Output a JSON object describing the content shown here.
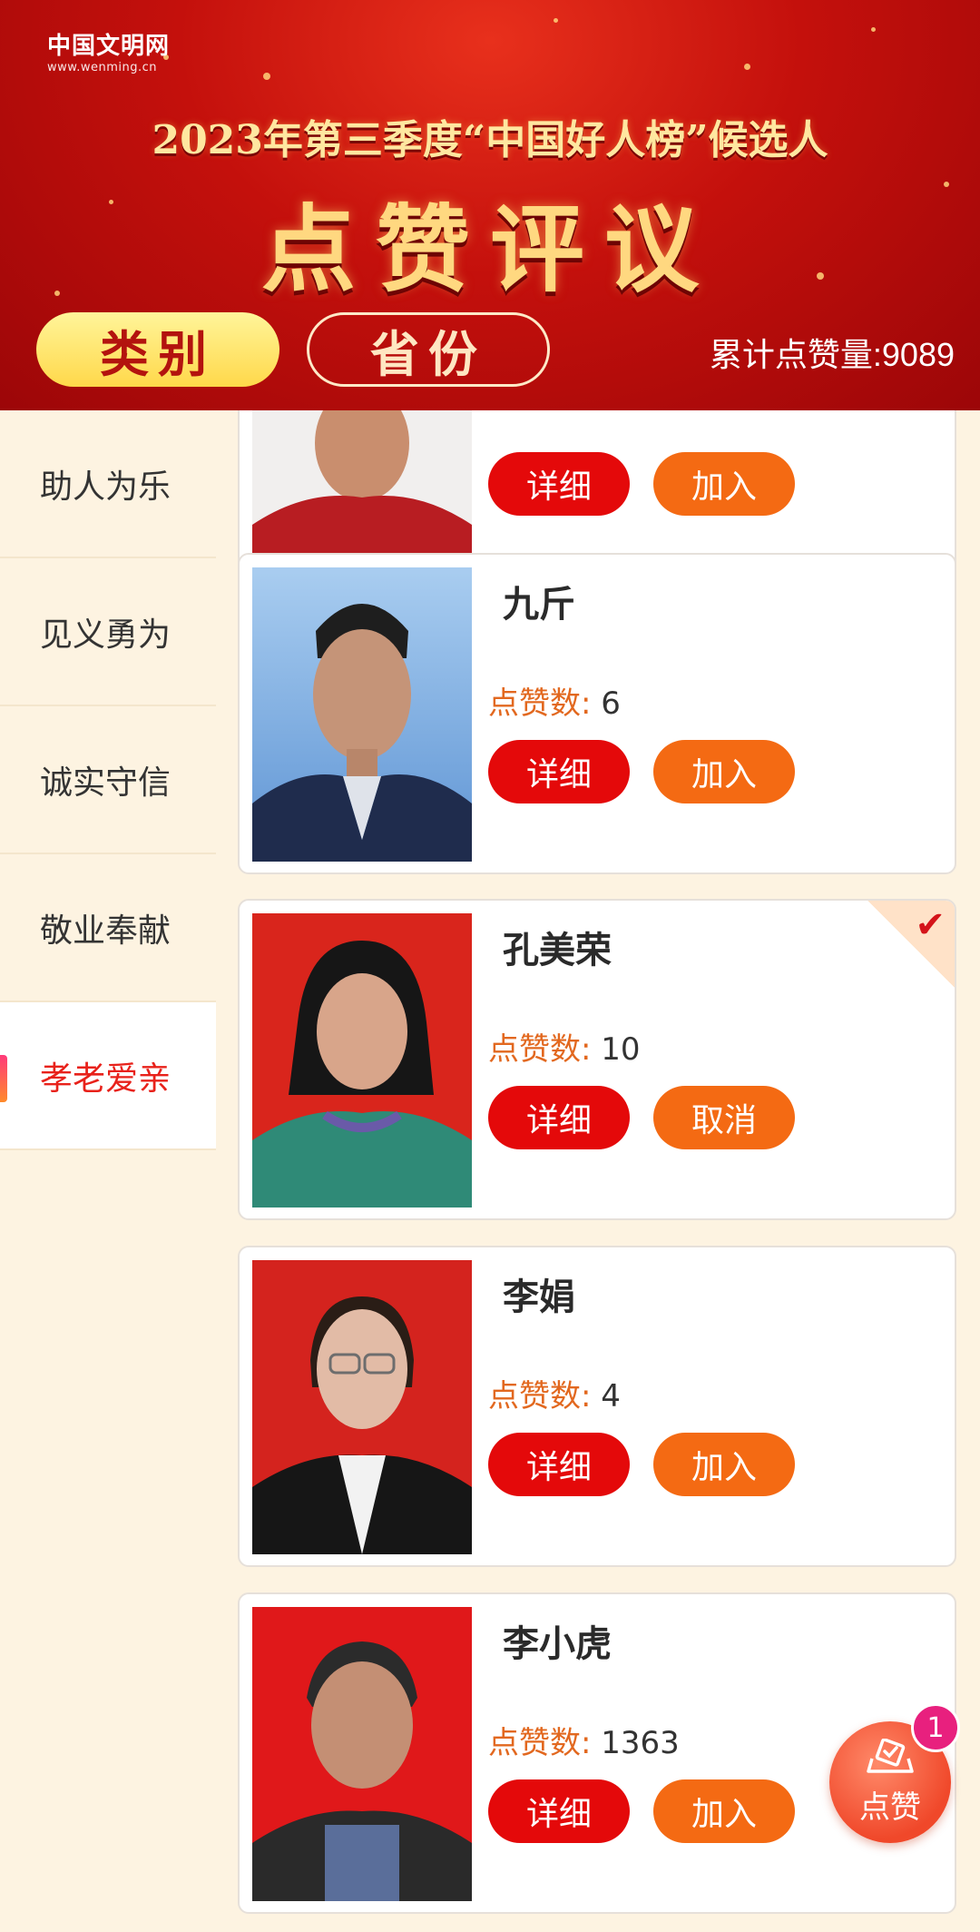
{
  "header": {
    "logo_cn": "中国文明网",
    "logo_url": "www.wenming.cn",
    "headline": "2023年第三季度“中国好人榜”候选人",
    "big_title": "点赞评议",
    "pill_category": "类别",
    "pill_province": "省份",
    "total_likes_label": "累计点赞量:9089"
  },
  "sidebar": {
    "items": [
      {
        "label": "助人为乐",
        "active": false
      },
      {
        "label": "见义勇为",
        "active": false
      },
      {
        "label": "诚实守信",
        "active": false
      },
      {
        "label": "敬业奉献",
        "active": false
      },
      {
        "label": "孝老爱亲",
        "active": true
      }
    ]
  },
  "cards": [
    {
      "name": "",
      "votes": "",
      "detail": "详细",
      "action": "加入",
      "selected": false,
      "partial": true
    },
    {
      "name": "九斤",
      "votes_label": "点赞数:",
      "votes": "6",
      "detail": "详细",
      "action": "加入",
      "selected": false
    },
    {
      "name": "孔美荣",
      "votes_label": "点赞数:",
      "votes": "10",
      "detail": "详细",
      "action": "取消",
      "selected": true
    },
    {
      "name": "李娟",
      "votes_label": "点赞数:",
      "votes": "4",
      "detail": "详细",
      "action": "加入",
      "selected": false
    },
    {
      "name": "李小虎",
      "votes_label": "点赞数:",
      "votes": "1363",
      "detail": "详细",
      "action": "加入",
      "selected": false
    }
  ],
  "fab": {
    "label": "点赞",
    "badge": "1"
  },
  "colors": {
    "banner_red": "#c4100c",
    "detail_red": "#e4090a",
    "join_orange": "#f46a13",
    "active_text": "#e8211a",
    "sidebar_bg": "#fdf3e1",
    "votes_label": "#e2681f"
  }
}
